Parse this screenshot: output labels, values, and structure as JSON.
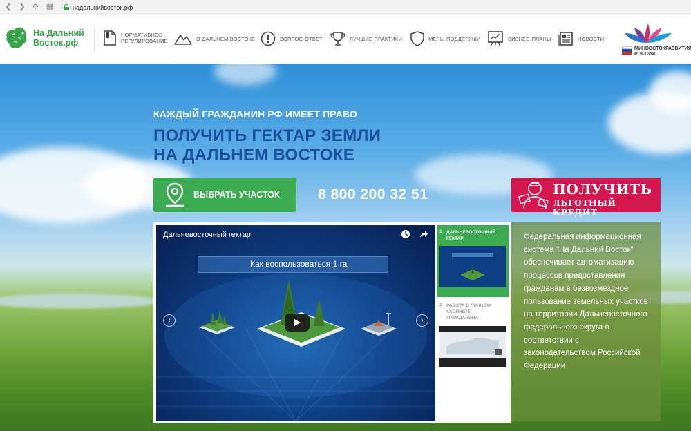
{
  "browser": {
    "url": "надальнийвосток.рф"
  },
  "header": {
    "logo_line1": "На Дальний",
    "logo_line2": "Восток.рф",
    "nav": [
      {
        "line1": "НОРМАТИВНОЕ",
        "line2": "РЕГУЛИРОВАНИЕ",
        "icon": "document-icon"
      },
      {
        "line1": "О ДАЛЬНЕМ ВОСТОКЕ",
        "line2": "",
        "icon": "mountains-icon"
      },
      {
        "line1": "ВОПРОС-ОТВЕТ",
        "line2": "",
        "icon": "exclamation-icon"
      },
      {
        "line1": "ЛУЧШИЕ ПРАКТИКИ",
        "line2": "",
        "icon": "trophy-icon"
      },
      {
        "line1": "МЕРЫ ПОДДЕРЖКИ",
        "line2": "",
        "icon": "shield-icon"
      },
      {
        "line1": "БИЗНЕС-ПЛАНЫ",
        "line2": "",
        "icon": "chart-board-icon"
      },
      {
        "line1": "НОВОСТИ",
        "line2": "",
        "icon": "newspaper-icon"
      }
    ],
    "ministry_line1": "МИНВОСТОКРАЗВИТИЯ",
    "ministry_line2": "РОССИИ"
  },
  "hero": {
    "kicker": "КАЖДЫЙ ГРАЖДАНИН РФ ИМЕЕТ ПРАВО",
    "headline_line1": "ПОЛУЧИТЬ ГЕКТАР ЗЕМЛИ",
    "headline_line2": "НА ДАЛЬНЕМ ВОСТОКЕ",
    "pick_button": "ВЫБРАТЬ УЧАСТОК",
    "phone": "8 800 200 32 51",
    "credit_line1": "ПОЛУЧИТЬ",
    "credit_line2": "ЛЬГОТНЫЙ КРЕДИТ"
  },
  "video": {
    "title": "Дальневосточный гектар",
    "banner": "Как воспользоваться 1 га",
    "playlist": [
      {
        "num": "1",
        "title_line1": "ДАЛЬНЕВОСТОЧНЫЙ",
        "title_line2": "ГЕКТАР",
        "title_line3": ""
      },
      {
        "num": "2",
        "title_line1": "РАБОТА В ЛИЧНОМ",
        "title_line2": "КАБИНЕТЕ",
        "title_line3": "ГРАЖДАНИНА"
      }
    ]
  },
  "info": {
    "text": "Федеральная информационная система \"На Дальний Восток\" обеспечивает автоматизацию процессов предоставления гражданам в безвозмездное пользование земельных участков на территории Дальневосточного федерального округа в соответствии с законодательством Российской Федерации"
  },
  "colors": {
    "brand_green": "#3cab52",
    "headline_blue": "#1a4f9c",
    "credit_red": "#d5174f"
  }
}
